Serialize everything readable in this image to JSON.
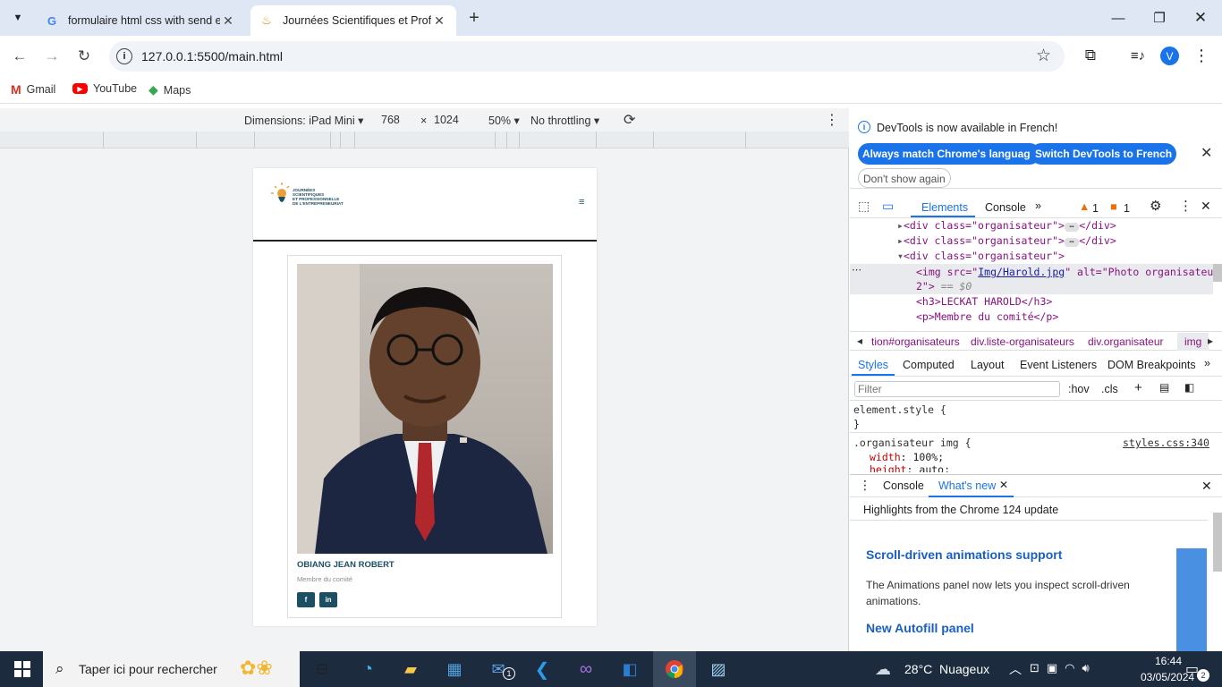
{
  "browser": {
    "tabs": [
      {
        "title": "formulaire html css with send e",
        "icon": "google-icon"
      },
      {
        "title": "Journées Scientifiques et Profes",
        "icon": "site-favicon"
      }
    ],
    "url": "127.0.0.1:5500/main.html",
    "profile_initial": "V",
    "bookmarks": [
      "Gmail",
      "YouTube",
      "Maps"
    ]
  },
  "device_toolbar": {
    "dimensions_label": "Dimensions: iPad Mini",
    "width": "768",
    "times": "×",
    "height": "1024",
    "zoom": "50%",
    "throttling": "No throttling"
  },
  "site": {
    "logo_lines": [
      "JOURNÉES",
      "SCIENTIFIQUES",
      "ET PROFESSIONNELLE",
      "DE L'ENTREPRENEURIAT"
    ],
    "menu_glyph": "≡",
    "member": {
      "name": "OBIANG JEAN ROBERT",
      "role": "Membre du comité"
    },
    "social": [
      "f",
      "in"
    ]
  },
  "devtools": {
    "notice": "DevTools is now available in French!",
    "btn_match": "Always match Chrome's language",
    "btn_switch": "Switch DevTools to French",
    "btn_dont": "Don't show again",
    "tabs": [
      "Elements",
      "Console"
    ],
    "warn_count": "1",
    "err_count": "1",
    "dom": {
      "l1": "<div class=\"organisateur\">",
      "l1_end": "</div>",
      "l2": "<div class=\"organisateur\">",
      "l2_end": "</div>",
      "l3": "<div class=\"organisateur\">",
      "img_a": "<img src=\"",
      "img_src": "Img/Harold.jpg",
      "img_b": "\" alt=\"Photo organisateur",
      "img_c": "2\">",
      "img_eq": "== $0",
      "h3": "<h3>LECKAT HAROLD</h3>",
      "p": "<p>Membre du comité</p>"
    },
    "crumbs": [
      "tion#organisateurs",
      "div.liste-organisateurs",
      "div.organisateur",
      "img"
    ],
    "style_tabs": [
      "Styles",
      "Computed",
      "Layout",
      "Event Listeners",
      "DOM Breakpoints"
    ],
    "filter_placeholder": "Filter",
    "hov": ":hov",
    "cls": ".cls",
    "element_style": "element.style {",
    "close_brace": "}",
    "rule_selector": ".organisateur img {",
    "rule_source": "styles.css:340",
    "prop1_name": "width",
    "prop1_val": "100%;",
    "prop2_name": "height",
    "prop2_val": "auto;",
    "drawer_tabs": [
      "Console",
      "What's new"
    ],
    "highlights": "Highlights from the Chrome 124 update",
    "h_scroll": "Scroll-driven animations support",
    "p_scroll": "The Animations panel now lets you inspect scroll-driven animations.",
    "h_autofill": "New Autofill panel"
  },
  "taskbar": {
    "search": "Taper ici pour rechercher",
    "weather": "28°C  Nuageux",
    "time": "16:44",
    "date": "03/05/2024",
    "notif_count": "2",
    "mail_badge": "1"
  },
  "colors": {
    "accent": "#1a73e8",
    "site_teal": "#1d4f64",
    "taskbar": "#1c2b3e"
  }
}
